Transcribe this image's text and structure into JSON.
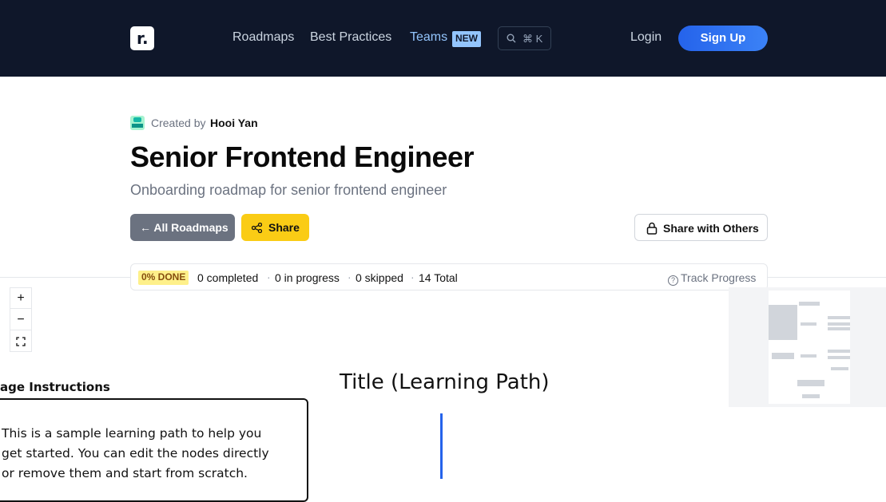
{
  "nav": {
    "logo_glyph": "r.",
    "links": [
      "Roadmaps",
      "Best Practices",
      "Teams"
    ],
    "new_badge": "NEW",
    "search_shortcut": "⌘ K",
    "login": "Login",
    "signup": "Sign Up"
  },
  "header": {
    "created_by_label": "Created by",
    "creator_name": "Hooi Yan",
    "title": "Senior Frontend Engineer",
    "subtitle": "Onboarding roadmap for senior frontend engineer",
    "all_roadmaps_button": "← All Roadmaps",
    "share_button": "Share",
    "share_with_others_button": "Share with Others"
  },
  "progress": {
    "done_badge": "0% DONE",
    "completed": "0 completed",
    "in_progress": "0 in progress",
    "skipped": "0 skipped",
    "total": "14 Total",
    "track_progress": "Track Progress"
  },
  "canvas": {
    "zoom_in": "+",
    "zoom_out": "−",
    "fit": "⛶",
    "usage_title": "age Instructions",
    "usage_text": "This is a sample learning path to help you get started. You can edit the nodes directly or remove them and start from scratch.",
    "learning_path_title": "Title (Learning Path)"
  },
  "colors": {
    "nav_bg": "#0f172a",
    "accent_blue": "#2563eb",
    "share_yellow": "#facc15",
    "done_badge_bg": "#fef08a"
  }
}
